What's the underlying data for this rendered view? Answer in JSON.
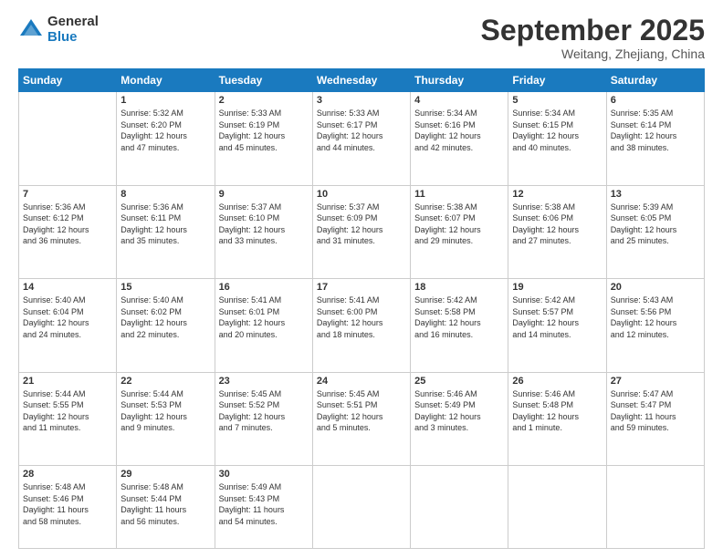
{
  "logo": {
    "general": "General",
    "blue": "Blue"
  },
  "header": {
    "title": "September 2025",
    "subtitle": "Weitang, Zhejiang, China"
  },
  "weekdays": [
    "Sunday",
    "Monday",
    "Tuesday",
    "Wednesday",
    "Thursday",
    "Friday",
    "Saturday"
  ],
  "weeks": [
    [
      {
        "day": "",
        "detail": ""
      },
      {
        "day": "1",
        "detail": "Sunrise: 5:32 AM\nSunset: 6:20 PM\nDaylight: 12 hours\nand 47 minutes."
      },
      {
        "day": "2",
        "detail": "Sunrise: 5:33 AM\nSunset: 6:19 PM\nDaylight: 12 hours\nand 45 minutes."
      },
      {
        "day": "3",
        "detail": "Sunrise: 5:33 AM\nSunset: 6:17 PM\nDaylight: 12 hours\nand 44 minutes."
      },
      {
        "day": "4",
        "detail": "Sunrise: 5:34 AM\nSunset: 6:16 PM\nDaylight: 12 hours\nand 42 minutes."
      },
      {
        "day": "5",
        "detail": "Sunrise: 5:34 AM\nSunset: 6:15 PM\nDaylight: 12 hours\nand 40 minutes."
      },
      {
        "day": "6",
        "detail": "Sunrise: 5:35 AM\nSunset: 6:14 PM\nDaylight: 12 hours\nand 38 minutes."
      }
    ],
    [
      {
        "day": "7",
        "detail": "Sunrise: 5:36 AM\nSunset: 6:12 PM\nDaylight: 12 hours\nand 36 minutes."
      },
      {
        "day": "8",
        "detail": "Sunrise: 5:36 AM\nSunset: 6:11 PM\nDaylight: 12 hours\nand 35 minutes."
      },
      {
        "day": "9",
        "detail": "Sunrise: 5:37 AM\nSunset: 6:10 PM\nDaylight: 12 hours\nand 33 minutes."
      },
      {
        "day": "10",
        "detail": "Sunrise: 5:37 AM\nSunset: 6:09 PM\nDaylight: 12 hours\nand 31 minutes."
      },
      {
        "day": "11",
        "detail": "Sunrise: 5:38 AM\nSunset: 6:07 PM\nDaylight: 12 hours\nand 29 minutes."
      },
      {
        "day": "12",
        "detail": "Sunrise: 5:38 AM\nSunset: 6:06 PM\nDaylight: 12 hours\nand 27 minutes."
      },
      {
        "day": "13",
        "detail": "Sunrise: 5:39 AM\nSunset: 6:05 PM\nDaylight: 12 hours\nand 25 minutes."
      }
    ],
    [
      {
        "day": "14",
        "detail": "Sunrise: 5:40 AM\nSunset: 6:04 PM\nDaylight: 12 hours\nand 24 minutes."
      },
      {
        "day": "15",
        "detail": "Sunrise: 5:40 AM\nSunset: 6:02 PM\nDaylight: 12 hours\nand 22 minutes."
      },
      {
        "day": "16",
        "detail": "Sunrise: 5:41 AM\nSunset: 6:01 PM\nDaylight: 12 hours\nand 20 minutes."
      },
      {
        "day": "17",
        "detail": "Sunrise: 5:41 AM\nSunset: 6:00 PM\nDaylight: 12 hours\nand 18 minutes."
      },
      {
        "day": "18",
        "detail": "Sunrise: 5:42 AM\nSunset: 5:58 PM\nDaylight: 12 hours\nand 16 minutes."
      },
      {
        "day": "19",
        "detail": "Sunrise: 5:42 AM\nSunset: 5:57 PM\nDaylight: 12 hours\nand 14 minutes."
      },
      {
        "day": "20",
        "detail": "Sunrise: 5:43 AM\nSunset: 5:56 PM\nDaylight: 12 hours\nand 12 minutes."
      }
    ],
    [
      {
        "day": "21",
        "detail": "Sunrise: 5:44 AM\nSunset: 5:55 PM\nDaylight: 12 hours\nand 11 minutes."
      },
      {
        "day": "22",
        "detail": "Sunrise: 5:44 AM\nSunset: 5:53 PM\nDaylight: 12 hours\nand 9 minutes."
      },
      {
        "day": "23",
        "detail": "Sunrise: 5:45 AM\nSunset: 5:52 PM\nDaylight: 12 hours\nand 7 minutes."
      },
      {
        "day": "24",
        "detail": "Sunrise: 5:45 AM\nSunset: 5:51 PM\nDaylight: 12 hours\nand 5 minutes."
      },
      {
        "day": "25",
        "detail": "Sunrise: 5:46 AM\nSunset: 5:49 PM\nDaylight: 12 hours\nand 3 minutes."
      },
      {
        "day": "26",
        "detail": "Sunrise: 5:46 AM\nSunset: 5:48 PM\nDaylight: 12 hours\nand 1 minute."
      },
      {
        "day": "27",
        "detail": "Sunrise: 5:47 AM\nSunset: 5:47 PM\nDaylight: 11 hours\nand 59 minutes."
      }
    ],
    [
      {
        "day": "28",
        "detail": "Sunrise: 5:48 AM\nSunset: 5:46 PM\nDaylight: 11 hours\nand 58 minutes."
      },
      {
        "day": "29",
        "detail": "Sunrise: 5:48 AM\nSunset: 5:44 PM\nDaylight: 11 hours\nand 56 minutes."
      },
      {
        "day": "30",
        "detail": "Sunrise: 5:49 AM\nSunset: 5:43 PM\nDaylight: 11 hours\nand 54 minutes."
      },
      {
        "day": "",
        "detail": ""
      },
      {
        "day": "",
        "detail": ""
      },
      {
        "day": "",
        "detail": ""
      },
      {
        "day": "",
        "detail": ""
      }
    ]
  ]
}
